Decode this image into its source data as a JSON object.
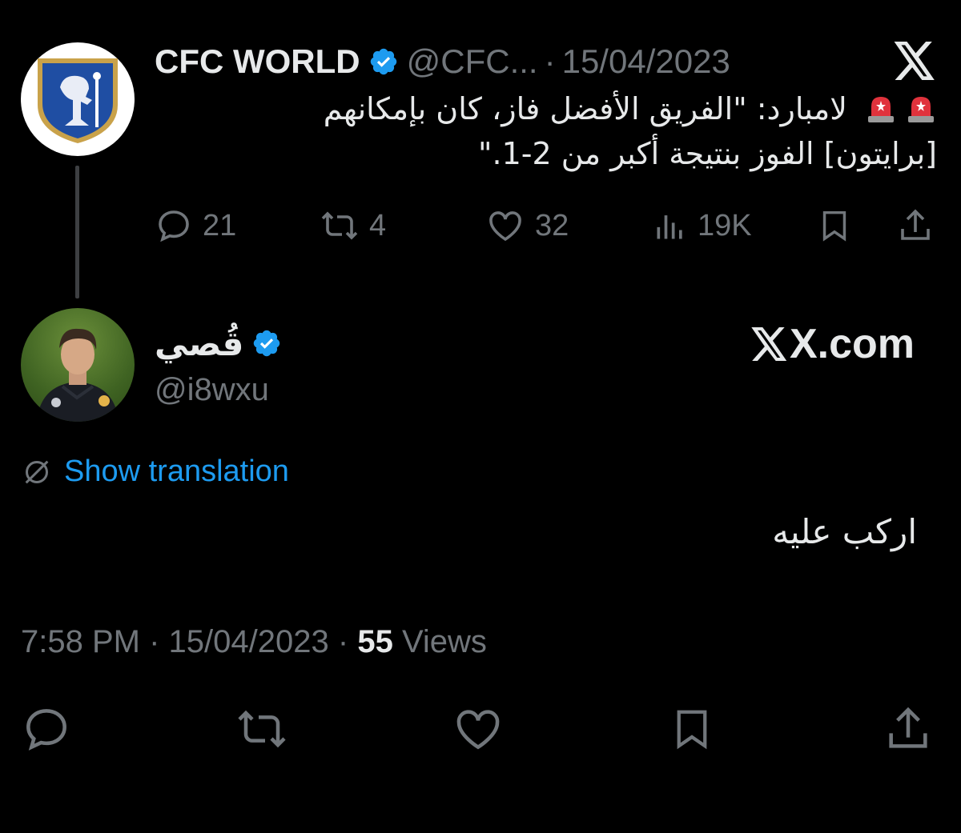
{
  "original_tweet": {
    "author_name": "CFC WORLD",
    "handle": "@CFC...",
    "separator": "·",
    "date": "15/04/2023",
    "text_line1": "لامبارد: \"الفريق الأفضل فاز، كان بإمكانهم",
    "text_line2": "[برايتون] الفوز بنتيجة أكبر من 2-1.\"",
    "emoji": "siren",
    "stats": {
      "replies": "21",
      "retweets": "4",
      "likes": "32",
      "views": "19K"
    }
  },
  "reply": {
    "author_name": "قُصي",
    "handle": "@i8wxu",
    "site_label": "X.com",
    "translate_label": "Show translation",
    "text": "اركب عليه",
    "time": "7:58 PM",
    "date": "15/04/2023",
    "views_count": "55",
    "views_label": "Views",
    "separator": "·"
  },
  "colors": {
    "background": "#000000",
    "text": "#e7e9ea",
    "muted": "#71767b",
    "link": "#1d9bf0",
    "verified": "#1d9bf0"
  },
  "icons": [
    "x-logo-icon",
    "verified-badge-icon",
    "siren-icon",
    "reply-icon",
    "retweet-icon",
    "like-icon",
    "views-icon",
    "bookmark-icon",
    "share-icon",
    "translate-icon"
  ]
}
